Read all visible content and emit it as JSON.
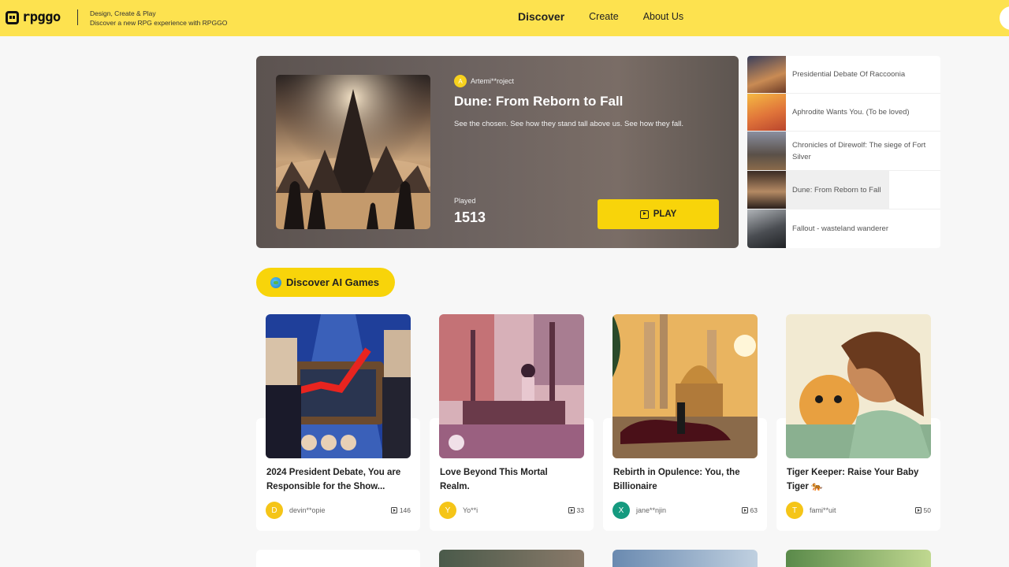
{
  "header": {
    "logo_text": "rpggo",
    "tagline_1": "Design, Create & Play",
    "tagline_2": "Discover a new RPG experience with RPGGO",
    "nav": [
      "Discover",
      "Create",
      "About Us"
    ]
  },
  "featured": {
    "author_initial": "A",
    "author": "Artemi**roject",
    "title": "Dune: From Reborn to Fall",
    "description": "See the chosen. See how they stand tall above us. See how they fall.",
    "played_label": "Played",
    "played_count": "1513",
    "play_label": "PLAY"
  },
  "side_list": [
    {
      "label": "Presidential Debate Of Raccoonia"
    },
    {
      "label": "Aphrodite Wants You. (To be loved)"
    },
    {
      "label": "Chronicles of Direwolf: The siege of Fort Silver"
    },
    {
      "label": "Dune: From Reborn to Fall"
    },
    {
      "label": "Fallout - wasteland wanderer"
    }
  ],
  "discover_label": "Discover AI Games",
  "cards": [
    {
      "title": "2024 President Debate, You are Responsible for the Show...",
      "initial": "D",
      "author": "devin**opie",
      "plays": "146",
      "avatar_color": "#f5c518"
    },
    {
      "title": "Love Beyond This Mortal Realm.",
      "initial": "Y",
      "author": "Yo**i",
      "plays": "33",
      "avatar_color": "#f5c518"
    },
    {
      "title": "Rebirth in Opulence: You, the Billionaire",
      "initial": "X",
      "author": "jane**njin",
      "plays": "63",
      "avatar_color": "#159a7f"
    },
    {
      "title": "Tiger Keeper: Raise Your Baby Tiger 🐅",
      "initial": "T",
      "author": "fami**uit",
      "plays": "50",
      "avatar_color": "#f5c518"
    }
  ],
  "colors": {
    "brand_yellow": "#fde24f",
    "button_yellow": "#f8d40a"
  }
}
